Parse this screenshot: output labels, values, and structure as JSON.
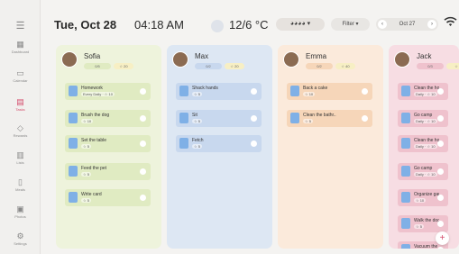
{
  "sidebar": {
    "items": [
      {
        "label": "Dashboard",
        "icon": "dashboard-icon",
        "glyph": "▦"
      },
      {
        "label": "Calendar",
        "icon": "calendar-icon",
        "glyph": "▭"
      },
      {
        "label": "Tasks",
        "icon": "tasks-icon",
        "glyph": "▤"
      },
      {
        "label": "Rewards",
        "icon": "rewards-icon",
        "glyph": "◇"
      },
      {
        "label": "Lists",
        "icon": "lists-icon",
        "glyph": "▥"
      },
      {
        "label": "Meals",
        "icon": "meals-icon",
        "glyph": "▯"
      },
      {
        "label": "Photos",
        "icon": "photos-icon",
        "glyph": "▣"
      },
      {
        "label": "Settings",
        "icon": "settings-icon",
        "glyph": "⚙"
      }
    ],
    "active": "Tasks"
  },
  "header": {
    "date": "Tue, Oct 28",
    "time": "04:18 AM",
    "temperature": "12/6 °C",
    "filter_label": "Filter ▾",
    "date_nav_label": "Oct 27",
    "avatar_group_label": "◕◕◕◕ ▾"
  },
  "columns": [
    {
      "name": "Sofia",
      "progress": "0/5",
      "points": "☆ 20",
      "bg": "#eef3dc",
      "card": "#e0ebc2",
      "tasks": [
        {
          "title": "Homework",
          "sub": "Every Daily · ☆ 10"
        },
        {
          "title": "Brush the dog",
          "sub": "☆ 10"
        },
        {
          "title": "Set the table",
          "sub": "☆ 5"
        },
        {
          "title": "Feed the pet",
          "sub": "☆ 5"
        },
        {
          "title": "Write card",
          "sub": "☆ 5"
        }
      ]
    },
    {
      "name": "Max",
      "progress": "0/2",
      "points": "☆ 20",
      "bg": "#dde7f3",
      "card": "#c8d8ee",
      "tasks": [
        {
          "title": "Shack hands",
          "sub": "☆ 5"
        },
        {
          "title": "Sit",
          "sub": "☆ 5"
        },
        {
          "title": "Fetch",
          "sub": "☆ 5"
        }
      ]
    },
    {
      "name": "Emma",
      "progress": "0/2",
      "points": "☆ 40",
      "bg": "#fbeadb",
      "card": "#f6d6b9",
      "tasks": [
        {
          "title": "Back a cake",
          "sub": "☆ 10"
        },
        {
          "title": "Clean the bathr..",
          "sub": "☆ 5"
        }
      ]
    },
    {
      "name": "Jack",
      "progress": "0/3",
      "points": "☆",
      "bg": "#f7dde3",
      "card": "#efc2cd",
      "tasks": [
        {
          "title": "Clean the house",
          "sub": "Daily · ☆ 10"
        },
        {
          "title": "Go camp",
          "sub": "Daily · ☆ 10"
        },
        {
          "title": "Clean the house",
          "sub": "Daily · ☆ 10"
        },
        {
          "title": "Go camp",
          "sub": "Daily · ☆ 10"
        },
        {
          "title": "Organize garage",
          "sub": "☆ 10"
        },
        {
          "title": "Walk the dog",
          "sub": "☆ 5"
        },
        {
          "title": "Vacuum the car",
          "sub": ""
        }
      ]
    }
  ],
  "fab_label": "+",
  "colors": {
    "accent": "#d44a6a",
    "icon_blue": "#7fb0e6"
  }
}
